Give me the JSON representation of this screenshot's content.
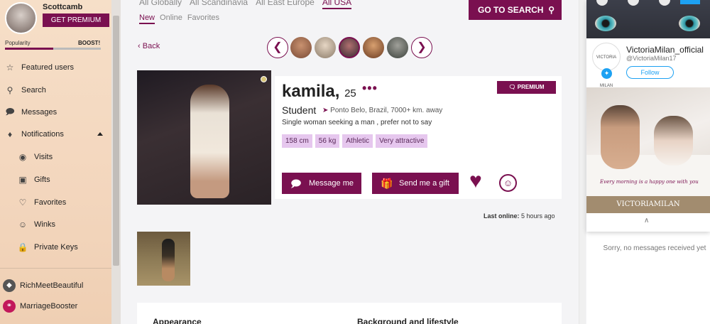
{
  "sidebar": {
    "username": "Scottcamb",
    "premium_label": "GET PREMIUM",
    "popularity_label": "Popularity",
    "popularity_value": 0.5,
    "boost_label": "BOOST!",
    "items": [
      {
        "label": "Featured users",
        "icon": "star-icon"
      },
      {
        "label": "Search",
        "icon": "search-icon"
      },
      {
        "label": "Messages",
        "icon": "chat-icon"
      },
      {
        "label": "Notifications",
        "icon": "bell-icon"
      },
      {
        "label": "Visits",
        "icon": "eye-icon"
      },
      {
        "label": "Gifts",
        "icon": "gift-icon"
      },
      {
        "label": "Favorites",
        "icon": "heart-icon"
      },
      {
        "label": "Winks",
        "icon": "wink-icon"
      },
      {
        "label": "Private Keys",
        "icon": "lock-icon"
      }
    ],
    "partners": [
      {
        "label": "RichMeetBeautiful",
        "icon": "diamond-icon"
      },
      {
        "label": "MarriageBooster",
        "icon": "ring-icon"
      }
    ]
  },
  "topnav": {
    "tabs": [
      "All Globally",
      "All Scandinavia",
      "All East Europe",
      "All USA"
    ],
    "active": "All USA",
    "subtabs": [
      "New",
      "Online",
      "Favorites"
    ],
    "active_sub": "New",
    "goto_label": "GO TO SEARCH"
  },
  "profile": {
    "back_label": "Back",
    "name": "kamila,",
    "age": "25",
    "premium_badge": "PREMIUM",
    "occupation": "Student",
    "location": "Ponto Belo, Brazil, 7000+ km. away",
    "seeking": "Single woman seeking a man , prefer not to say",
    "tags": [
      "158 cm",
      "56 kg",
      "Athletic",
      "Very attractive"
    ],
    "message_label": "Message me",
    "gift_label": "Send me a gift",
    "last_online_label": "Last online:",
    "last_online_value": "5 hours ago"
  },
  "sections": {
    "appearance": "Appearance",
    "background": "Background and lifestyle"
  },
  "right_panel": {
    "twitter_name": "VictoriaMilan_official",
    "twitter_handle": "@VictoriaMilan17",
    "follow_label": "Follow",
    "logo_text": "VICTORIA MILAN",
    "ad_script": "Every morning is a happy one with you",
    "ad_brand": "VICTORIAMILAN",
    "no_messages": "Sorry, no messages received yet"
  },
  "colors": {
    "brand": "#7a1050",
    "tag_bg": "#e6c7ee",
    "twitter": "#1da1f2"
  }
}
